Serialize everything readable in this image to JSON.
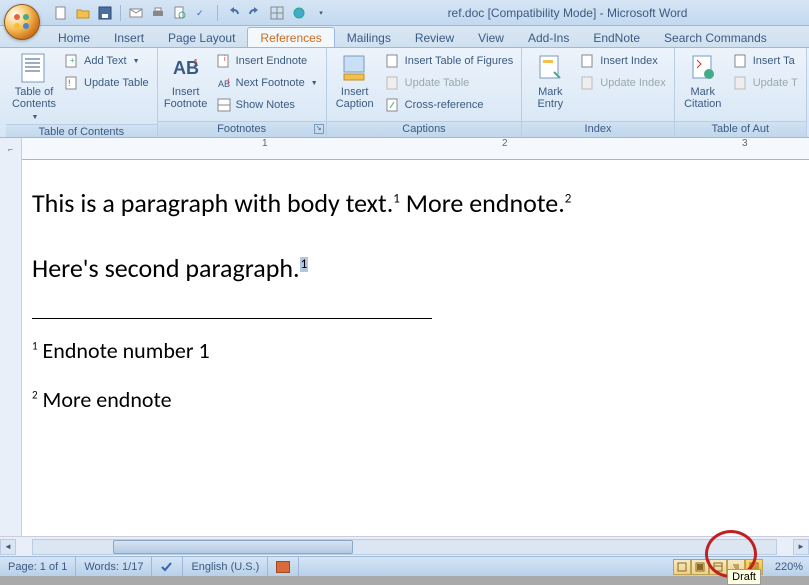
{
  "title": "ref.doc [Compatibility Mode] - Microsoft Word",
  "qat_icons": [
    "new-icon",
    "open-icon",
    "save-icon",
    "mail-icon",
    "print-icon",
    "preview-icon",
    "spell-icon",
    "undo-icon",
    "redo-icon",
    "table-icon",
    "hyperlink-icon"
  ],
  "tabs": [
    "Home",
    "Insert",
    "Page Layout",
    "References",
    "Mailings",
    "Review",
    "View",
    "Add-Ins",
    "EndNote",
    "Search Commands"
  ],
  "active_tab": "References",
  "ribbon": {
    "groups": [
      {
        "label": "Table of Contents",
        "big": {
          "label": "Table of\nContents",
          "icon": "toc-icon",
          "dd": true
        },
        "items": [
          {
            "label": "Add Text",
            "icon": "add-text-icon",
            "dd": true
          },
          {
            "label": "Update Table",
            "icon": "update-icon"
          }
        ]
      },
      {
        "label": "Footnotes",
        "big": {
          "label": "Insert\nFootnote",
          "icon": "footnote-icon"
        },
        "items": [
          {
            "label": "Insert Endnote",
            "icon": "endnote-icon"
          },
          {
            "label": "Next Footnote",
            "icon": "next-footnote-icon",
            "dd": true
          },
          {
            "label": "Show Notes",
            "icon": "show-notes-icon"
          }
        ],
        "launcher": true
      },
      {
        "label": "Captions",
        "big": {
          "label": "Insert\nCaption",
          "icon": "caption-icon"
        },
        "items": [
          {
            "label": "Insert Table of Figures",
            "icon": "tof-icon"
          },
          {
            "label": "Update Table",
            "icon": "update2-icon",
            "disabled": true
          },
          {
            "label": "Cross-reference",
            "icon": "crossref-icon"
          }
        ]
      },
      {
        "label": "Index",
        "big": {
          "label": "Mark\nEntry",
          "icon": "mark-entry-icon"
        },
        "items": [
          {
            "label": "Insert Index",
            "icon": "insert-index-icon"
          },
          {
            "label": "Update Index",
            "icon": "update3-icon",
            "disabled": true
          }
        ]
      },
      {
        "label": "Table of Aut",
        "big": {
          "label": "Mark\nCitation",
          "icon": "mark-cite-icon"
        },
        "items": [
          {
            "label": "Insert Ta",
            "icon": "insert-ta-icon"
          },
          {
            "label": "Update T",
            "icon": "update4-icon",
            "disabled": true
          }
        ]
      }
    ]
  },
  "ruler_marks": [
    "1",
    "2",
    "3"
  ],
  "document": {
    "para1_a": "This is a paragraph with body text.",
    "para1_s1": "1",
    "para1_b": "  More endnote.",
    "para1_s2": "2",
    "para2_a": "Here's second paragraph.",
    "para2_s1": "1",
    "end1_s": "1",
    "end1_t": " Endnote number 1",
    "end2_s": "2",
    "end2_t": " More endnote"
  },
  "status": {
    "page": "Page: 1 of 1",
    "words": "Words: 1/17",
    "lang": "English (U.S.)",
    "zoom": "220%"
  },
  "tooltip": "Draft",
  "colors": {
    "accent": "#3b5a82",
    "ribbon_bg": "#d6e6f5",
    "highlight": "#ffd77a"
  }
}
